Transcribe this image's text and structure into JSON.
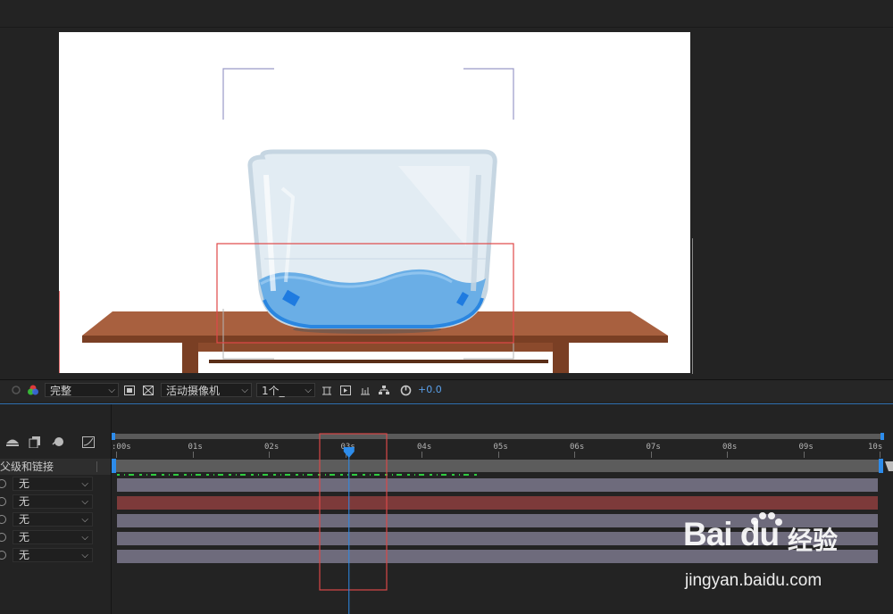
{
  "toolbar": {
    "resolution": "完整",
    "camera": "活动摄像机",
    "views": "1个_",
    "exposure": "+0.0"
  },
  "timeline": {
    "parent_header": "父级和链接",
    "time_labels": [
      ":00s",
      "01s",
      "02s",
      "03s",
      "04s",
      "05s",
      "06s",
      "07s",
      "08s",
      "09s",
      "10s"
    ],
    "layers": [
      {
        "parent": "无",
        "color": "#6e6b7c"
      },
      {
        "parent": "无",
        "color": "#7d3a3a"
      },
      {
        "parent": "无",
        "color": "#6e6b7c"
      },
      {
        "parent": "无",
        "color": "#6e6b7c"
      },
      {
        "parent": "无",
        "color": "#6e6b7c"
      }
    ],
    "playhead_seconds": 3.05,
    "duration_seconds": 10
  },
  "watermark": {
    "brand": "Bai du",
    "brand_cn": "经验",
    "url": "jingyan.baidu.com"
  },
  "colors": {
    "accent_blue": "#2d8ceb",
    "annotation_red": "#e04848"
  }
}
